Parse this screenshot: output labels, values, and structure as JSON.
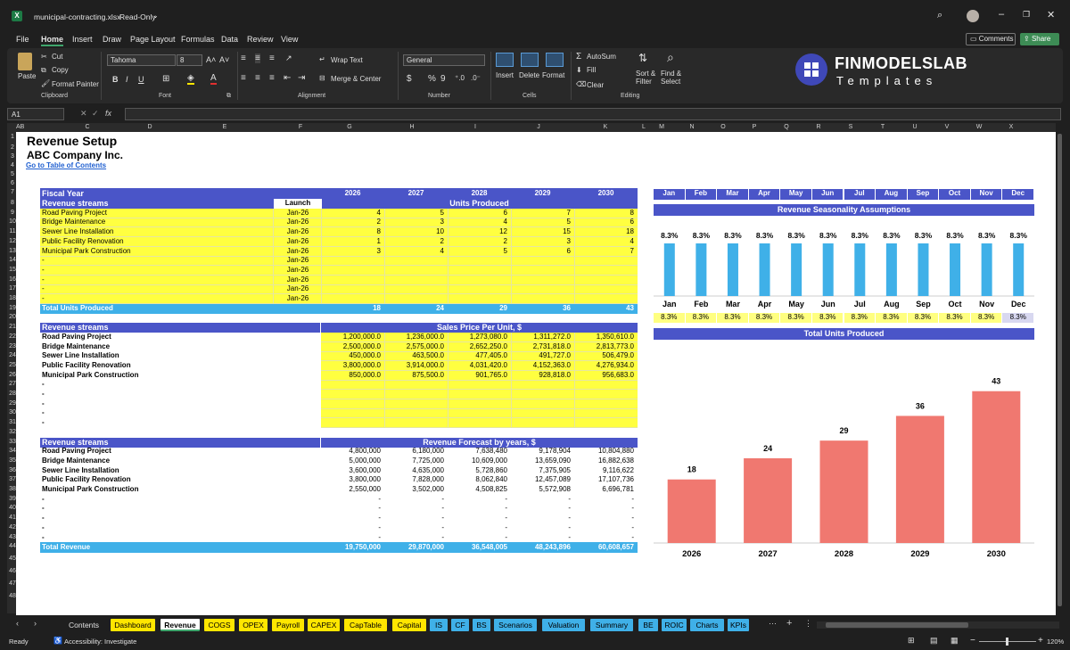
{
  "window": {
    "filename": "municipal-contracting.xlsx",
    "mode": "Read-Only"
  },
  "menu": [
    "File",
    "Home",
    "Insert",
    "Draw",
    "Page Layout",
    "Formulas",
    "Data",
    "Review",
    "View"
  ],
  "actions": {
    "comments": "Comments",
    "share": "Share"
  },
  "ribbon": {
    "paste": "Paste",
    "cut": "Cut",
    "copy": "Copy",
    "format_painter": "Format Painter",
    "clipboard": "Clipboard",
    "font_name": "Tahoma",
    "font_size": "8",
    "font": "Font",
    "wrap_text": "Wrap Text",
    "merge_center": "Merge & Center",
    "alignment": "Alignment",
    "number_format": "General",
    "number": "Number",
    "insert": "Insert",
    "delete": "Delete",
    "format": "Format",
    "cells": "Cells",
    "autosum": "AutoSum",
    "fill": "Fill",
    "clear": "Clear",
    "sort_filter": "Sort & Filter",
    "find_select": "Find & Select",
    "editing": "Editing",
    "brand": "FINMODELSLAB",
    "brand_sub": "Templates"
  },
  "formula_bar": {
    "cell_ref": "A1",
    "fx": "fx"
  },
  "columns": [
    "A",
    "B",
    "C",
    "D",
    "E",
    "F",
    "G",
    "H",
    "I",
    "J",
    "K",
    "L",
    "M",
    "N",
    "O",
    "P",
    "Q",
    "R",
    "S",
    "T",
    "U",
    "V",
    "W",
    "X"
  ],
  "rows": [
    "1",
    "2",
    "3",
    "4",
    "5",
    "6",
    "7",
    "8",
    "9",
    "10",
    "11",
    "12",
    "13",
    "14",
    "15",
    "16",
    "17",
    "18",
    "19",
    "20",
    "21",
    "22",
    "23",
    "24",
    "25",
    "26",
    "27",
    "28",
    "29",
    "30",
    "31",
    "32",
    "33",
    "34",
    "35",
    "36",
    "37",
    "38",
    "39",
    "40",
    "41",
    "42",
    "43",
    "44",
    "45",
    "46",
    "47",
    "48"
  ],
  "sheet": {
    "title": "Revenue Setup",
    "company": "ABC Company Inc.",
    "toc_link": "Go to Table of Contents",
    "fiscal_year_label": "Fiscal Year",
    "years": [
      "2026",
      "2027",
      "2028",
      "2029",
      "2030"
    ],
    "streams_label": "Revenue streams",
    "launch_label": "Launch",
    "units_title": "Units Produced",
    "units_rows": [
      {
        "name": "Road Paving Project",
        "launch": "Jan-26",
        "vals": [
          "4",
          "5",
          "6",
          "7",
          "8"
        ]
      },
      {
        "name": "Bridge Maintenance",
        "launch": "Jan-26",
        "vals": [
          "2",
          "3",
          "4",
          "5",
          "6"
        ]
      },
      {
        "name": "Sewer Line Installation",
        "launch": "Jan-26",
        "vals": [
          "8",
          "10",
          "12",
          "15",
          "18"
        ]
      },
      {
        "name": "Public Facility Renovation",
        "launch": "Jan-26",
        "vals": [
          "1",
          "2",
          "2",
          "3",
          "4"
        ]
      },
      {
        "name": "Municipal Park Construction",
        "launch": "Jan-26",
        "vals": [
          "3",
          "4",
          "5",
          "6",
          "7"
        ]
      },
      {
        "name": "-",
        "launch": "Jan-26",
        "vals": [
          "",
          "",
          "",
          "",
          ""
        ]
      },
      {
        "name": "-",
        "launch": "Jan-26",
        "vals": [
          "",
          "",
          "",
          "",
          ""
        ]
      },
      {
        "name": "-",
        "launch": "Jan-26",
        "vals": [
          "",
          "",
          "",
          "",
          ""
        ]
      },
      {
        "name": "-",
        "launch": "Jan-26",
        "vals": [
          "",
          "",
          "",
          "",
          ""
        ]
      },
      {
        "name": "-",
        "launch": "Jan-26",
        "vals": [
          "",
          "",
          "",
          "",
          ""
        ]
      }
    ],
    "total_units_label": "Total Units Produced",
    "total_units": [
      "18",
      "24",
      "29",
      "36",
      "43"
    ],
    "price_title": "Sales Price Per Unit, $",
    "price_rows": [
      {
        "name": "Road Paving Project",
        "vals": [
          "1,200,000.0",
          "1,236,000.0",
          "1,273,080.0",
          "1,311,272.0",
          "1,350,610.0"
        ]
      },
      {
        "name": "Bridge Maintenance",
        "vals": [
          "2,500,000.0",
          "2,575,000.0",
          "2,652,250.0",
          "2,731,818.0",
          "2,813,773.0"
        ]
      },
      {
        "name": "Sewer Line Installation",
        "vals": [
          "450,000.0",
          "463,500.0",
          "477,405.0",
          "491,727.0",
          "506,479.0"
        ]
      },
      {
        "name": "Public Facility Renovation",
        "vals": [
          "3,800,000.0",
          "3,914,000.0",
          "4,031,420.0",
          "4,152,363.0",
          "4,276,934.0"
        ]
      },
      {
        "name": "Municipal Park Construction",
        "vals": [
          "850,000.0",
          "875,500.0",
          "901,765.0",
          "928,818.0",
          "956,683.0"
        ]
      },
      {
        "name": "-",
        "vals": [
          "",
          "",
          "",
          "",
          ""
        ]
      },
      {
        "name": "-",
        "vals": [
          "",
          "",
          "",
          "",
          ""
        ]
      },
      {
        "name": "-",
        "vals": [
          "",
          "",
          "",
          "",
          ""
        ]
      },
      {
        "name": "-",
        "vals": [
          "",
          "",
          "",
          "",
          ""
        ]
      },
      {
        "name": "-",
        "vals": [
          "",
          "",
          "",
          "",
          ""
        ]
      }
    ],
    "forecast_title": "Revenue Forecast by years, $",
    "forecast_rows": [
      {
        "name": "Road Paving Project",
        "vals": [
          "4,800,000",
          "6,180,000",
          "7,638,480",
          "9,178,904",
          "10,804,880"
        ]
      },
      {
        "name": "Bridge Maintenance",
        "vals": [
          "5,000,000",
          "7,725,000",
          "10,609,000",
          "13,659,090",
          "16,882,638"
        ]
      },
      {
        "name": "Sewer Line Installation",
        "vals": [
          "3,600,000",
          "4,635,000",
          "5,728,860",
          "7,375,905",
          "9,116,622"
        ]
      },
      {
        "name": "Public Facility Renovation",
        "vals": [
          "3,800,000",
          "7,828,000",
          "8,062,840",
          "12,457,089",
          "17,107,736"
        ]
      },
      {
        "name": "Municipal Park Construction",
        "vals": [
          "2,550,000",
          "3,502,000",
          "4,508,825",
          "5,572,908",
          "6,696,781"
        ]
      },
      {
        "name": "-",
        "vals": [
          "-",
          "-",
          "-",
          "-",
          "-"
        ]
      },
      {
        "name": "-",
        "vals": [
          "-",
          "-",
          "-",
          "-",
          "-"
        ]
      },
      {
        "name": "-",
        "vals": [
          "-",
          "-",
          "-",
          "-",
          "-"
        ]
      },
      {
        "name": "-",
        "vals": [
          "-",
          "-",
          "-",
          "-",
          "-"
        ]
      },
      {
        "name": "-",
        "vals": [
          "-",
          "-",
          "-",
          "-",
          "-"
        ]
      }
    ],
    "total_revenue_label": "Total Revenue",
    "total_revenue": [
      "19,750,000",
      "29,870,000",
      "36,548,005",
      "48,243,896",
      "60,608,657"
    ],
    "months": [
      "Jan",
      "Feb",
      "Mar",
      "Apr",
      "May",
      "Jun",
      "Jul",
      "Aug",
      "Sep",
      "Oct",
      "Nov",
      "Dec"
    ],
    "seasonality_title": "Revenue Seasonality Assumptions",
    "seasonality_pct": [
      "8.3%",
      "8.3%",
      "8.3%",
      "8.3%",
      "8.3%",
      "8.3%",
      "8.3%",
      "8.3%",
      "8.3%",
      "8.3%",
      "8.3%",
      "8.3%"
    ],
    "total_units_chart_title": "Total Units Produced"
  },
  "chart_data": [
    {
      "type": "bar",
      "title": "Revenue Seasonality Assumptions",
      "categories": [
        "Jan",
        "Feb",
        "Mar",
        "Apr",
        "May",
        "Jun",
        "Jul",
        "Aug",
        "Sep",
        "Oct",
        "Nov",
        "Dec"
      ],
      "values": [
        8.3,
        8.3,
        8.3,
        8.3,
        8.3,
        8.3,
        8.3,
        8.3,
        8.3,
        8.3,
        8.3,
        8.3
      ],
      "labels": [
        "8.3%",
        "8.3%",
        "8.3%",
        "8.3%",
        "8.3%",
        "8.3%",
        "8.3%",
        "8.3%",
        "8.3%",
        "8.3%",
        "8.3%",
        "8.3%"
      ],
      "color": "#3fb0e8",
      "ylim": [
        0,
        9
      ]
    },
    {
      "type": "bar",
      "title": "Total Units Produced",
      "categories": [
        "2026",
        "2027",
        "2028",
        "2029",
        "2030"
      ],
      "values": [
        18,
        24,
        29,
        36,
        43
      ],
      "color": "#f07870",
      "ylim": [
        0,
        50
      ]
    }
  ],
  "tabs": [
    {
      "label": "Contents",
      "color": "#1f1f1f",
      "text": "#e0e0e0"
    },
    {
      "label": "Dashboard",
      "color": "#ffe600",
      "text": "#000"
    },
    {
      "label": "Revenue",
      "color": "#ffffff",
      "text": "#000",
      "active": true
    },
    {
      "label": "COGS",
      "color": "#ffe600",
      "text": "#000"
    },
    {
      "label": "OPEX",
      "color": "#ffe600",
      "text": "#000"
    },
    {
      "label": "Payroll",
      "color": "#ffe600",
      "text": "#000"
    },
    {
      "label": "CAPEX",
      "color": "#ffe600",
      "text": "#000"
    },
    {
      "label": "CapTable",
      "color": "#ffe600",
      "text": "#000"
    },
    {
      "label": "Capital",
      "color": "#ffe600",
      "text": "#000"
    },
    {
      "label": "IS",
      "color": "#3fb0e8",
      "text": "#000"
    },
    {
      "label": "CF",
      "color": "#3fb0e8",
      "text": "#000"
    },
    {
      "label": "BS",
      "color": "#3fb0e8",
      "text": "#000"
    },
    {
      "label": "Scenarios",
      "color": "#3fb0e8",
      "text": "#000"
    },
    {
      "label": "Valuation",
      "color": "#3fb0e8",
      "text": "#000"
    },
    {
      "label": "Summary",
      "color": "#3fb0e8",
      "text": "#000"
    },
    {
      "label": "BE",
      "color": "#3fb0e8",
      "text": "#000"
    },
    {
      "label": "ROIC",
      "color": "#3fb0e8",
      "text": "#000"
    },
    {
      "label": "Charts",
      "color": "#3fb0e8",
      "text": "#000"
    },
    {
      "label": "KPIs",
      "color": "#3fb0e8",
      "text": "#000"
    }
  ],
  "status": {
    "ready": "Ready",
    "accessibility": "Accessibility: Investigate",
    "zoom": "120%"
  }
}
